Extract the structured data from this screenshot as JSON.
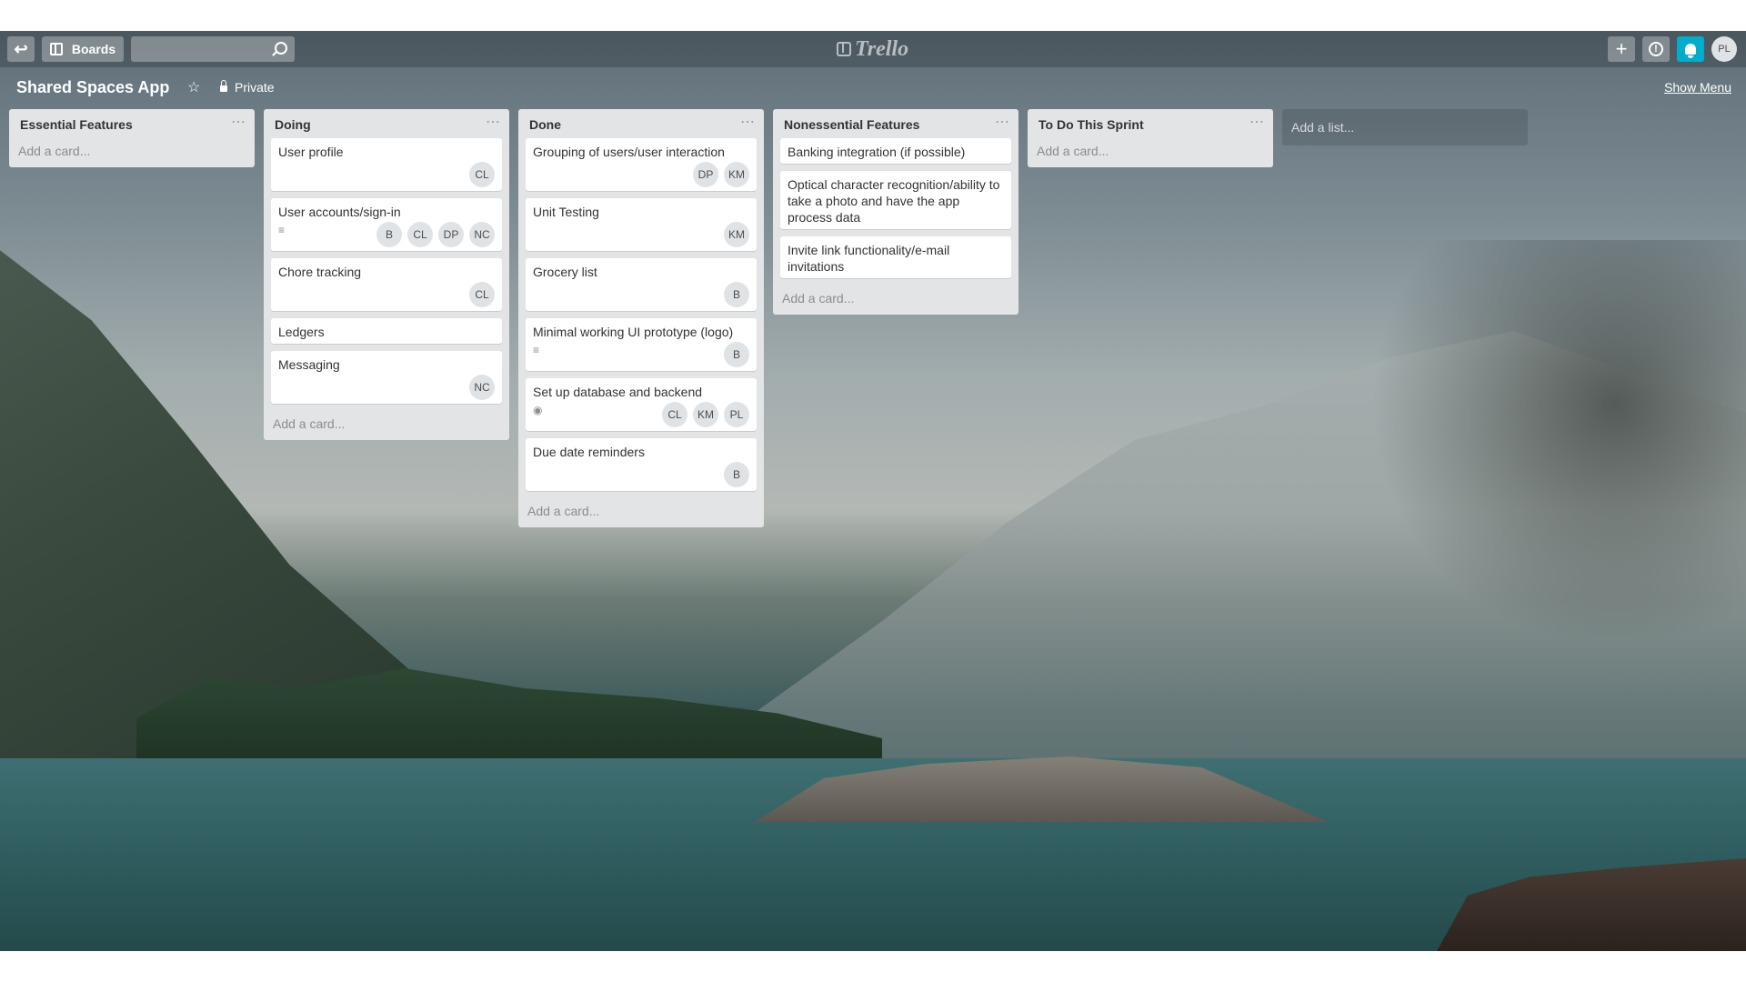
{
  "header": {
    "boards_label": "Boards",
    "logo_text": "Trello",
    "user_initials": "PL"
  },
  "board": {
    "title": "Shared Spaces App",
    "visibility": "Private",
    "show_menu": "Show Menu"
  },
  "add_list_label": "Add a list...",
  "add_card_label": "Add a card...",
  "lists": [
    {
      "title": "Essential Features",
      "cards": []
    },
    {
      "title": "Doing",
      "cards": [
        {
          "text": "User profile",
          "members": [
            "CL"
          ]
        },
        {
          "text": "User accounts/sign-in",
          "icon": "description-icon",
          "members": [
            "B",
            "CL",
            "DP",
            "NC"
          ]
        },
        {
          "text": "Chore tracking",
          "members": [
            "CL"
          ]
        },
        {
          "text": "Ledgers",
          "members": []
        },
        {
          "text": "Messaging",
          "members": [
            "NC"
          ]
        }
      ]
    },
    {
      "title": "Done",
      "cards": [
        {
          "text": "Grouping of users/user interaction",
          "members": [
            "DP",
            "KM"
          ]
        },
        {
          "text": "Unit Testing",
          "members": [
            "KM"
          ]
        },
        {
          "text": "Grocery list",
          "members": [
            "B"
          ]
        },
        {
          "text": "Minimal working UI prototype (logo)",
          "icon": "description-icon",
          "members": [
            "B"
          ]
        },
        {
          "text": "Set up database and backend",
          "icon": "eye-icon",
          "members": [
            "CL",
            "KM",
            "PL"
          ]
        },
        {
          "text": "Due date reminders",
          "members": [
            "B"
          ]
        }
      ]
    },
    {
      "title": "Nonessential Features",
      "cards": [
        {
          "text": "Banking integration (if possible)",
          "members": []
        },
        {
          "text": "Optical character recognition/ability to take a photo and have the app process data",
          "members": []
        },
        {
          "text": "Invite link functionality/e-mail invitations",
          "members": []
        }
      ]
    },
    {
      "title": "To Do This Sprint",
      "cards": []
    }
  ],
  "colors": {
    "notification_accent": "#00aecc",
    "list_background": "#e2e4e6"
  }
}
